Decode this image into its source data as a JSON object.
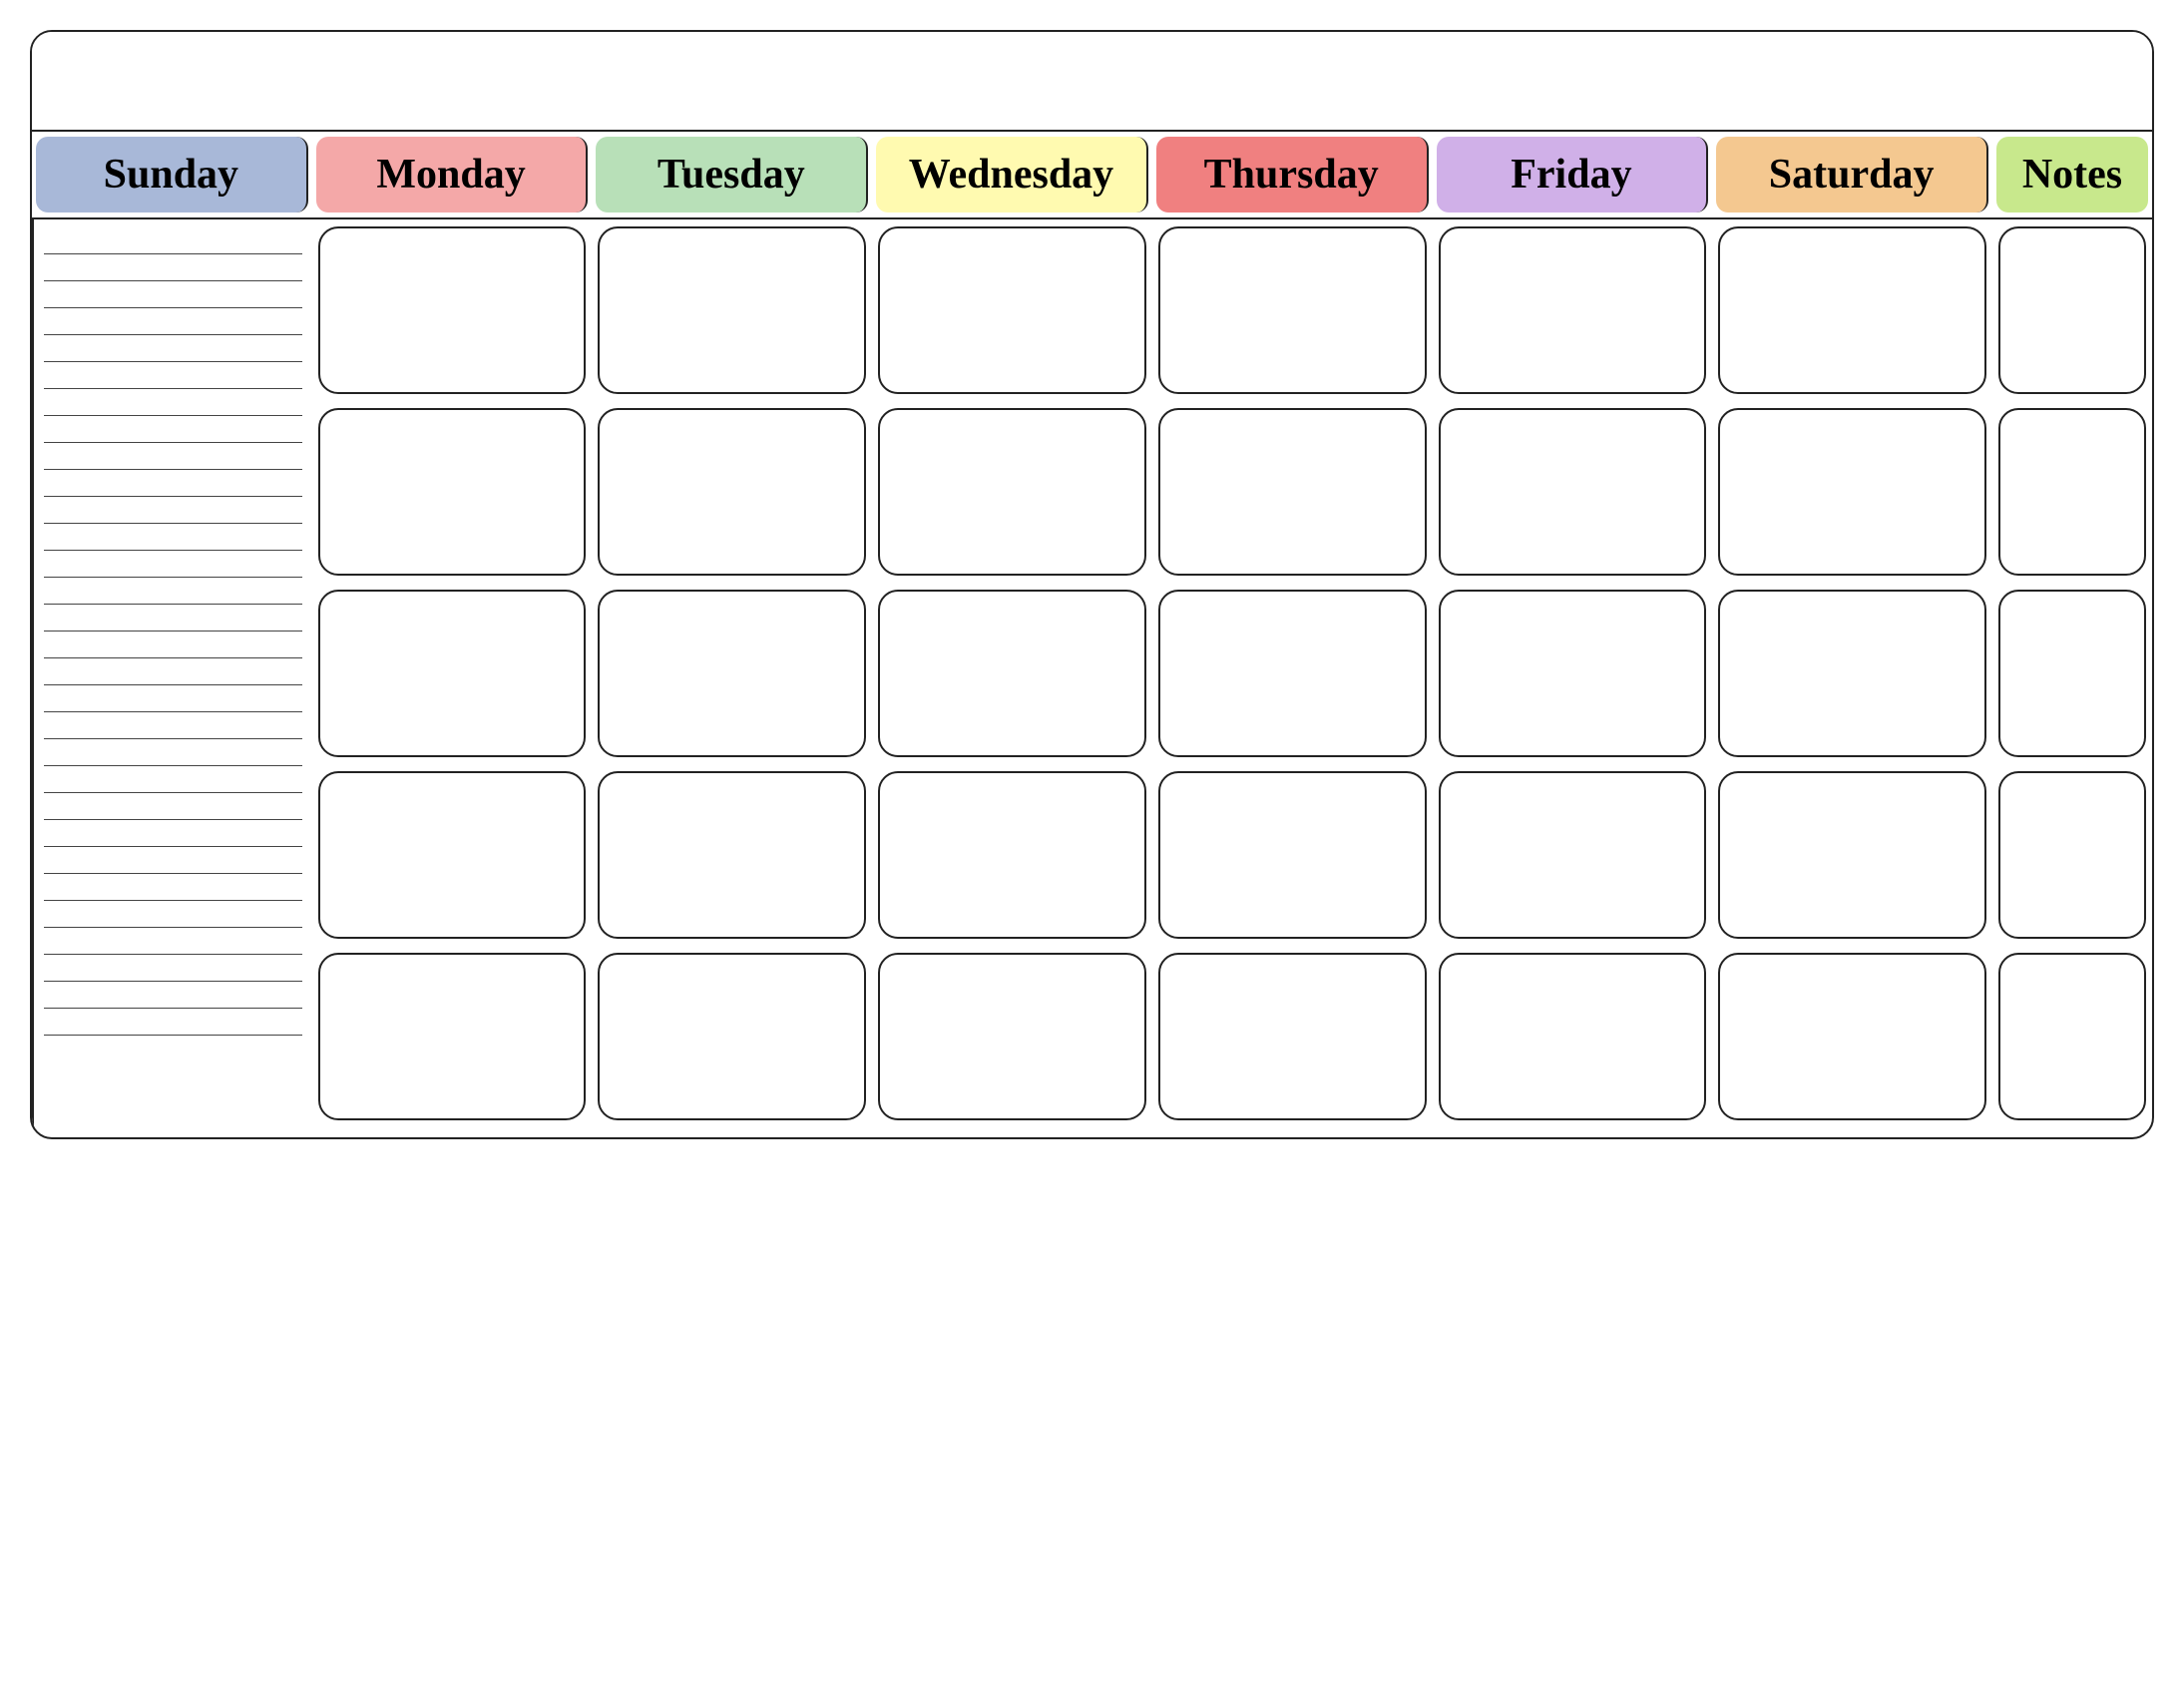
{
  "calendar": {
    "title": "",
    "headers": [
      {
        "id": "sunday",
        "label": "Sunday",
        "class": "col-sunday"
      },
      {
        "id": "monday",
        "label": "Monday",
        "class": "col-monday"
      },
      {
        "id": "tuesday",
        "label": "Tuesday",
        "class": "col-tuesday"
      },
      {
        "id": "wednesday",
        "label": "Wednesday",
        "class": "col-wednesday"
      },
      {
        "id": "thursday",
        "label": "Thursday",
        "class": "col-thursday"
      },
      {
        "id": "friday",
        "label": "Friday",
        "class": "col-friday"
      },
      {
        "id": "saturday",
        "label": "Saturday",
        "class": "col-saturday"
      },
      {
        "id": "notes",
        "label": "Notes",
        "class": "col-notes"
      }
    ],
    "rows": 5,
    "cols": 7,
    "note_lines": 30
  }
}
